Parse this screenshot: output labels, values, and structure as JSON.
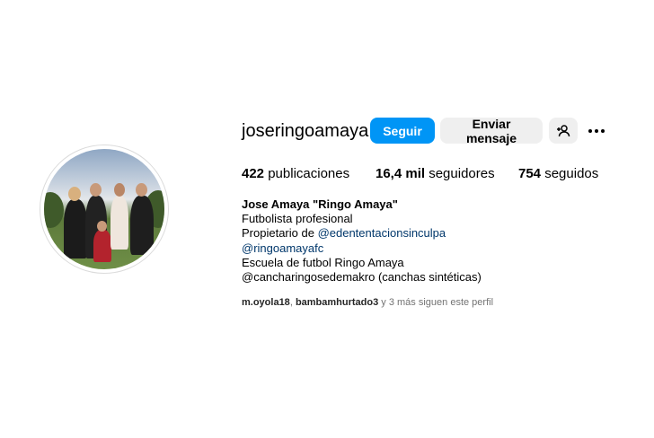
{
  "profile": {
    "username": "joseringoamaya",
    "buttons": {
      "follow": "Seguir",
      "message": "Enviar mensaje"
    },
    "icons": {
      "suggest": "add-person-icon",
      "more": "more-options-icon"
    },
    "stats": {
      "posts_count": "422",
      "posts_label": "publicaciones",
      "followers_count": "16,4 mil",
      "followers_label": "seguidores",
      "following_count": "754",
      "following_label": "seguidos"
    },
    "bio": {
      "full_name": "Jose Amaya \"Ringo Amaya\"",
      "line1": "Futbolista profesional",
      "line2_prefix": "Propietario de ",
      "line2_link": "@edententacionsinculpa",
      "line3_link": "@ringoamayafc",
      "line4": "Escuela de futbol Ringo Amaya",
      "line5": "@cancharingosedemakro (canchas sintéticas)"
    },
    "followed_by": {
      "user1": "m.oyola18",
      "separator": ", ",
      "user2": "bambamhurtado3",
      "suffix": " y 3 más siguen este perfil"
    }
  },
  "colors": {
    "primary": "#0095f6",
    "secondary_button": "#efefef",
    "link": "#00376b",
    "muted_text": "#737373"
  }
}
